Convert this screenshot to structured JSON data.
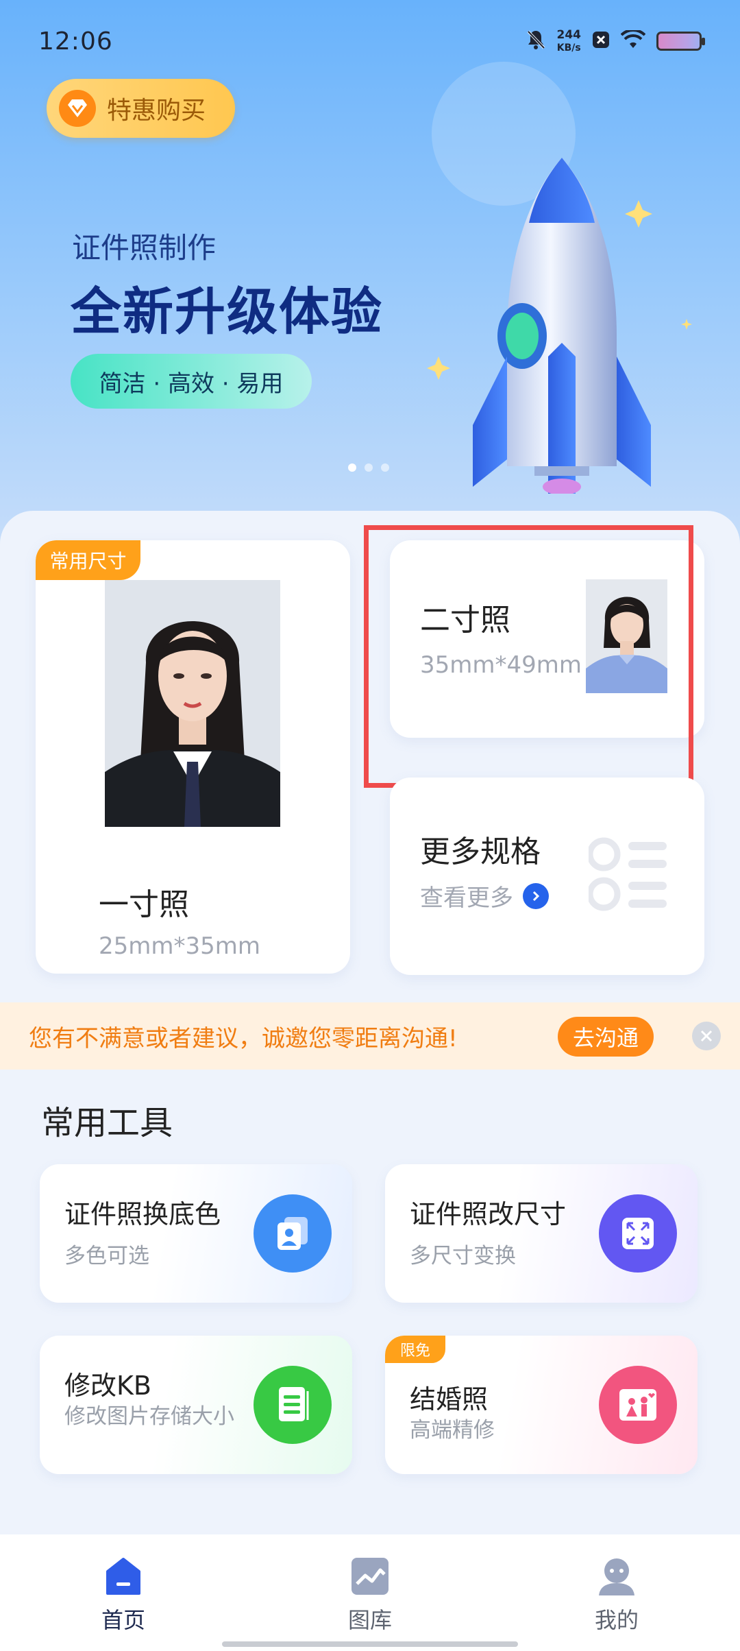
{
  "status_bar": {
    "time": "12:06",
    "net_speed_value": "244",
    "net_speed_unit": "KB/s",
    "icons": [
      "mute-icon",
      "app-notification-icon",
      "wifi-icon",
      "battery-icon"
    ]
  },
  "hero": {
    "promo_label": "特惠购买",
    "subtitle": "证件照制作",
    "title": "全新升级体验",
    "tagline": "简洁 · 高效 · 易用",
    "carousel_total": 3,
    "carousel_active": 1
  },
  "cards": {
    "one_inch": {
      "badge": "常用尺寸",
      "title": "一寸照",
      "size": "25mm*35mm"
    },
    "two_inch": {
      "title": "二寸照",
      "size": "35mm*49mm"
    },
    "more": {
      "title": "更多规格",
      "link": "查看更多"
    }
  },
  "notice": {
    "text": "您有不满意或者建议，诚邀您零距离沟通!",
    "button": "去沟通"
  },
  "tools": {
    "heading": "常用工具",
    "items": [
      {
        "title": "证件照换底色",
        "subtitle": "多色可选",
        "icon": "background-color-icon",
        "color": "#3f8ff5"
      },
      {
        "title": "证件照改尺寸",
        "subtitle": "多尺寸变换",
        "icon": "resize-icon",
        "color": "#6257f2"
      },
      {
        "title": "修改KB",
        "subtitle": "修改图片存储大小",
        "icon": "file-size-icon",
        "color": "#38c944"
      },
      {
        "title": "结婚照",
        "subtitle": "高端精修",
        "icon": "wedding-photo-icon",
        "color": "#f2557f",
        "badge": "限免"
      }
    ]
  },
  "bottom_nav": {
    "items": [
      {
        "label": "首页",
        "icon": "home-icon",
        "active": true
      },
      {
        "label": "图库",
        "icon": "gallery-icon",
        "active": false
      },
      {
        "label": "我的",
        "icon": "profile-icon",
        "active": false
      }
    ]
  },
  "colors": {
    "accent_blue": "#2563eb",
    "orange": "#ff8a18",
    "highlight_red": "#ef4b4b"
  }
}
